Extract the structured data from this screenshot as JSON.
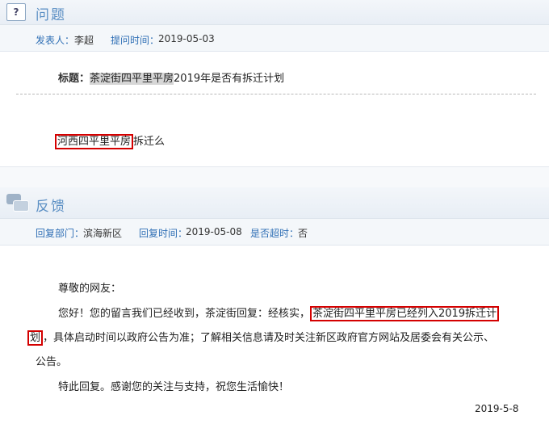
{
  "question": {
    "section_title": "问题",
    "poster_label": "发表人：",
    "poster": "李超",
    "asked_time_label": "提问时间：",
    "asked_time": "2019-05-03",
    "subject_label": "标题：",
    "subject_highlight": "茶淀街四平里平房",
    "subject_rest": "2019年是否有拆迁计划",
    "body_highlight": "河西四平里平房",
    "body_rest": "拆迁么"
  },
  "feedback": {
    "section_title": "反馈",
    "dept_label": "回复部门：",
    "dept": "滨海新区",
    "reply_time_label": "回复时间：",
    "reply_time": "2019-05-08",
    "overdue_label": "是否超时：",
    "overdue": "否",
    "greeting": "尊敬的网友：",
    "line1_a": "您好！您的留言我们已经收到，茶淀街回复：经核实，",
    "line1_box": "茶淀街四平里平房已经列入2019拆迁计",
    "line2_box": "划",
    "line2_a": "，具体启动时间以政府公告为准；了解相关信息请及时关注新区政府官方网站及居委会有关公示、",
    "line3": "公告。",
    "closing": "特此回复。感谢您的关注与支持，祝您生活愉快！",
    "date": "2019-5-8"
  }
}
